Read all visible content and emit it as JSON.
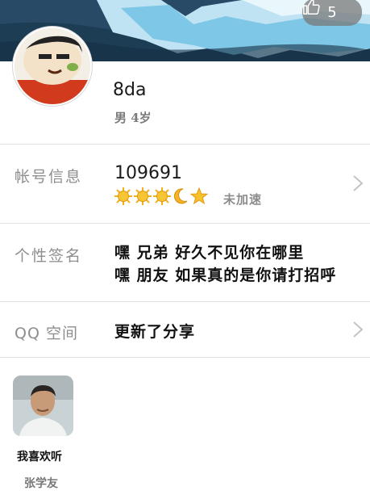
{
  "cover": {
    "likes": "5",
    "like_icon": "thumbs-up-icon"
  },
  "profile": {
    "nickname": "8da",
    "gender_age": "男 4岁"
  },
  "account": {
    "label": "帐号信息",
    "number": "109691",
    "level_icons": [
      "sun-icon",
      "sun-icon",
      "sun-icon",
      "moon-icon",
      "star-icon"
    ],
    "speed_status": "未加速"
  },
  "signature": {
    "label": "个性签名",
    "lines": [
      "嘿 兄弟 好久不见你在哪里",
      "嘿 朋友 如果真的是你请打招呼"
    ]
  },
  "qzone": {
    "label": "QQ 空间",
    "value": "更新了分享"
  },
  "music": {
    "title": "我喜欢听",
    "artist": "张学友"
  },
  "colors": {
    "divider": "#e2e2e2",
    "label_gray": "#8e8e8e",
    "sun": "#f2b01e",
    "moon": "#f2b01e"
  }
}
